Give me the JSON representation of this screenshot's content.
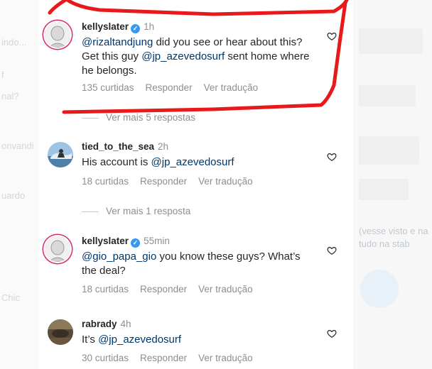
{
  "background": {
    "left_fragments": [
      "indo...",
      "f",
      "nal?",
      "onvandi",
      "uardo",
      "Chic"
    ],
    "right_fragments": [
      "(vesse visto e na",
      "tudo na stab"
    ]
  },
  "comments": [
    {
      "username": "kellyslater",
      "verified": true,
      "time": "1h",
      "text_parts": [
        {
          "t": "@rizaltandjung",
          "mention": true
        },
        {
          "t": " did you see or hear about this? Get this guy ",
          "mention": false
        },
        {
          "t": "@jp_azevedosurf",
          "mention": true
        },
        {
          "t": " sent home where he belongs.",
          "mention": false
        }
      ],
      "likes": "135 curtidas",
      "reply": "Responder",
      "translate": "Ver tradução",
      "more_replies": "Ver mais 5 respostas"
    },
    {
      "username": "tied_to_the_sea",
      "verified": false,
      "time": "2h",
      "text_parts": [
        {
          "t": "His account is ",
          "mention": false
        },
        {
          "t": "@jp_azevedosurf",
          "mention": true
        }
      ],
      "likes": "18 curtidas",
      "reply": "Responder",
      "translate": "Ver tradução",
      "more_replies": "Ver mais 1 resposta"
    },
    {
      "username": "kellyslater",
      "verified": true,
      "time": "55min",
      "text_parts": [
        {
          "t": "@gio_papa_gio",
          "mention": true
        },
        {
          "t": " you know these guys? What’s the deal?",
          "mention": false
        }
      ],
      "likes": "18 curtidas",
      "reply": "Responder",
      "translate": "Ver tradução"
    },
    {
      "username": "rabrady",
      "verified": false,
      "time": "4h",
      "text_parts": [
        {
          "t": "It’s ",
          "mention": false
        },
        {
          "t": "@jp_azevedosurf",
          "mention": true
        }
      ],
      "likes": "30 curtidas",
      "reply": "Responder",
      "translate": "Ver tradução"
    }
  ],
  "colors": {
    "mention": "#00376b",
    "meta": "#8e8e8e",
    "verified": "#3897f0",
    "annotation": "#e8191b",
    "story_ring": "#d62976"
  },
  "icons": [
    "verified-badge-icon",
    "heart-icon"
  ]
}
